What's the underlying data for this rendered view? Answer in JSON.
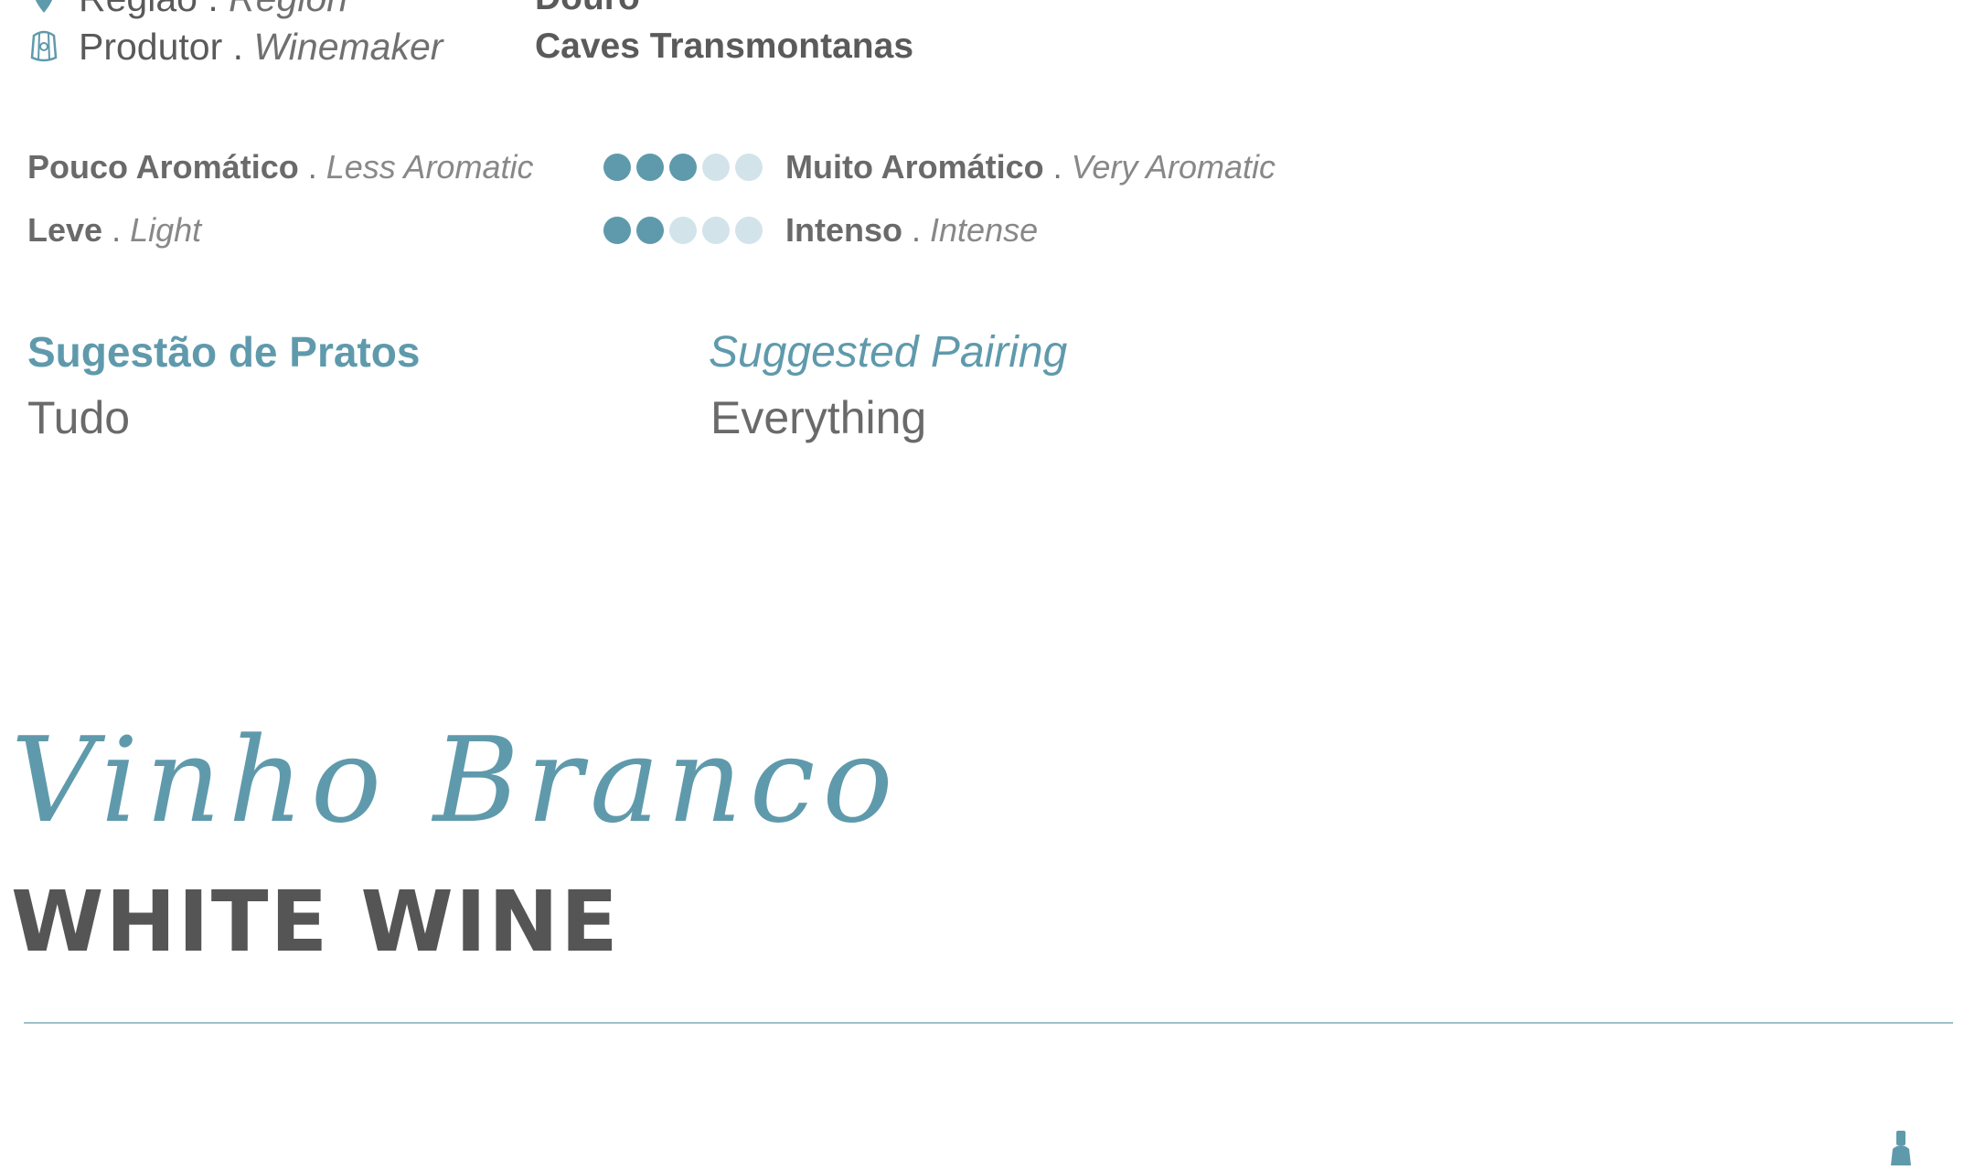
{
  "info": {
    "region": {
      "label_pt": "Região",
      "label_en": "Region",
      "value": "Douro",
      "icon": "map-pin-icon"
    },
    "producer": {
      "label_pt": "Produtor",
      "label_en": "Winemaker",
      "value": "Caves Transmontanas",
      "icon": "barrel-icon"
    }
  },
  "scales": [
    {
      "left_pt": "Pouco Aromático",
      "left_en": "Less Aromatic",
      "right_pt": "Muito Aromático",
      "right_en": "Very Aromatic",
      "level": 3,
      "max": 5
    },
    {
      "left_pt": "Leve",
      "left_en": "Light",
      "right_pt": "Intenso",
      "right_en": "Intense",
      "level": 2,
      "max": 5
    }
  ],
  "pairing": {
    "heading_pt": "Sugestão de Pratos",
    "heading_en": "Suggested Pairing",
    "value_pt": "Tudo",
    "value_en": "Everything"
  },
  "section": {
    "script_title": "Vinho Branco",
    "title": "WHITE WINE"
  },
  "colors": {
    "accent": "#5f9aac",
    "accent_light": "#d2e4ea",
    "text": "#5a5a5a"
  }
}
